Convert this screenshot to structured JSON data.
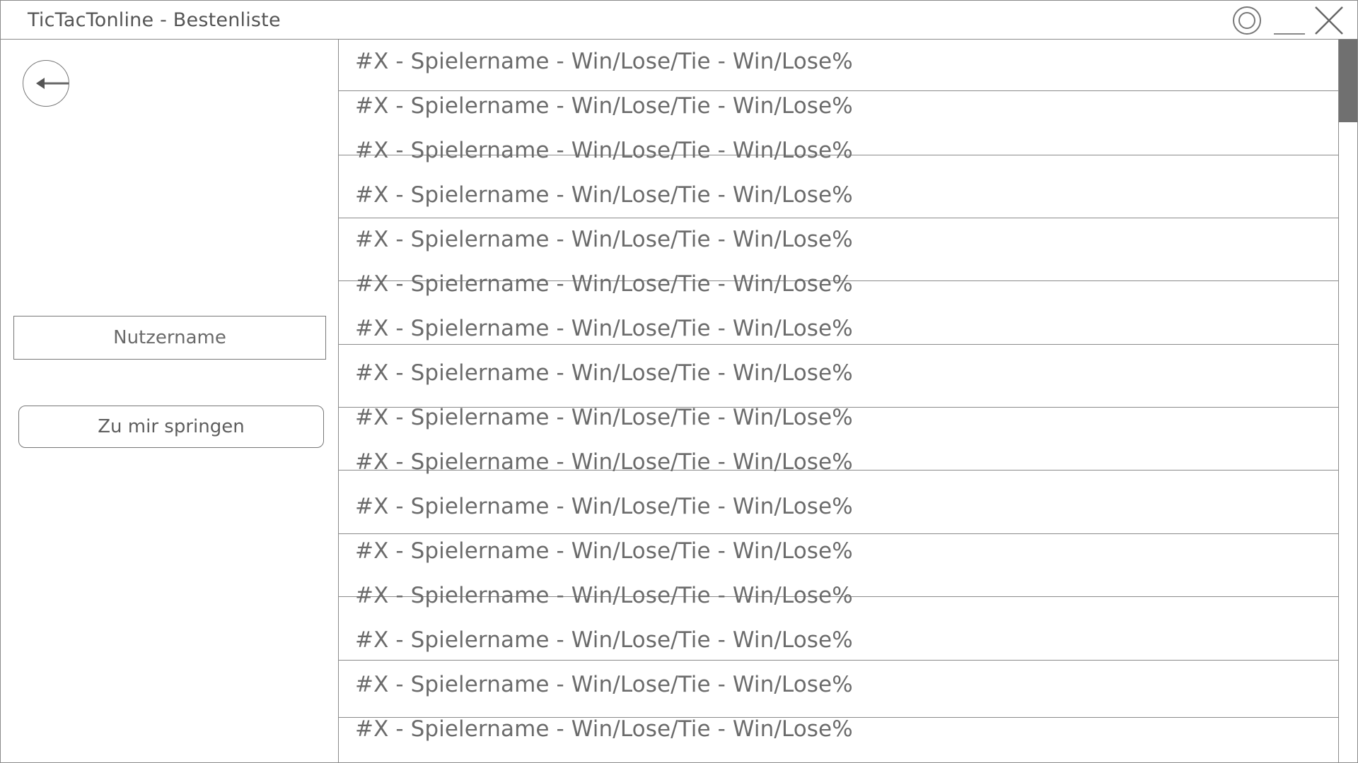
{
  "window": {
    "title": "TicTacTonline - Bestenliste"
  },
  "titlebar": {
    "icons": [
      "settings-icon",
      "minimize-icon",
      "close-icon"
    ]
  },
  "sidebar": {
    "back_icon": "arrow-left-icon",
    "username_placeholder": "Nutzername",
    "jump_button_label": "Zu mir springen"
  },
  "leaderboard": {
    "entries": [
      "#X - Spielername - Win/Lose/Tie - Win/Lose%",
      "#X - Spielername - Win/Lose/Tie - Win/Lose%",
      "#X - Spielername - Win/Lose/Tie - Win/Lose%",
      "#X - Spielername - Win/Lose/Tie - Win/Lose%",
      "#X - Spielername - Win/Lose/Tie - Win/Lose%",
      "#X - Spielername - Win/Lose/Tie - Win/Lose%",
      "#X - Spielername - Win/Lose/Tie - Win/Lose%",
      "#X - Spielername - Win/Lose/Tie - Win/Lose%",
      "#X - Spielername - Win/Lose/Tie - Win/Lose%",
      "#X - Spielername - Win/Lose/Tie - Win/Lose%",
      "#X - Spielername - Win/Lose/Tie - Win/Lose%",
      "#X - Spielername - Win/Lose/Tie - Win/Lose%",
      "#X - Spielername - Win/Lose/Tie - Win/Lose%",
      "#X - Spielername - Win/Lose/Tie - Win/Lose%",
      "#X - Spielername - Win/Lose/Tie - Win/Lose%",
      "#X - Spielername - Win/Lose/Tie - Win/Lose%"
    ]
  },
  "colors": {
    "line": "#8a8a8a",
    "text": "#6b6b6b",
    "scroll_thumb": "#707070"
  }
}
